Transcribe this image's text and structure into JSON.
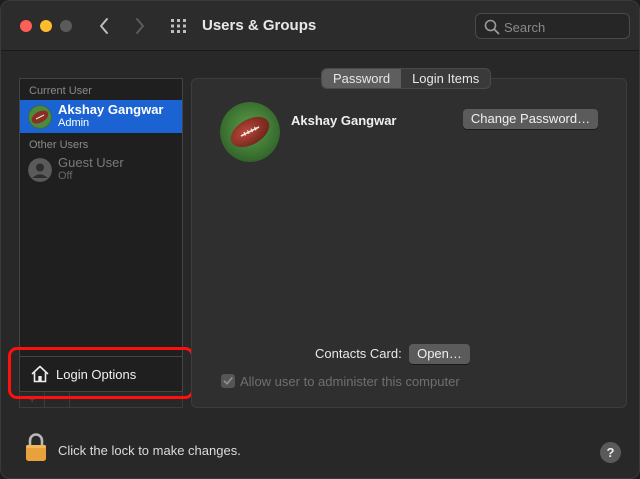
{
  "window": {
    "title": "Users & Groups",
    "search_placeholder": "Search"
  },
  "sidebar": {
    "current_user_label": "Current User",
    "other_users_label": "Other Users",
    "users": [
      {
        "name": "Akshay Gangwar",
        "role": "Admin",
        "selected": true,
        "avatar_icon": "football-avatar-icon"
      },
      {
        "name": "Guest User",
        "role": "Off",
        "selected": false,
        "avatar_icon": "person-icon"
      }
    ],
    "login_options_label": "Login Options",
    "add_label": "+",
    "remove_label": "−"
  },
  "tabs": [
    {
      "label": "Password",
      "active": true
    },
    {
      "label": "Login Items",
      "active": false
    }
  ],
  "main": {
    "user_name": "Akshay Gangwar",
    "change_password_label": "Change Password…",
    "contacts_card_label": "Contacts Card:",
    "open_label": "Open…",
    "allow_admin_label": "Allow user to administer this computer",
    "allow_admin_checked": true
  },
  "footer": {
    "lock_text": "Click the lock to make changes.",
    "help_label": "?"
  },
  "colors": {
    "accent": "#1b63d3",
    "highlight": "#ff1010"
  }
}
